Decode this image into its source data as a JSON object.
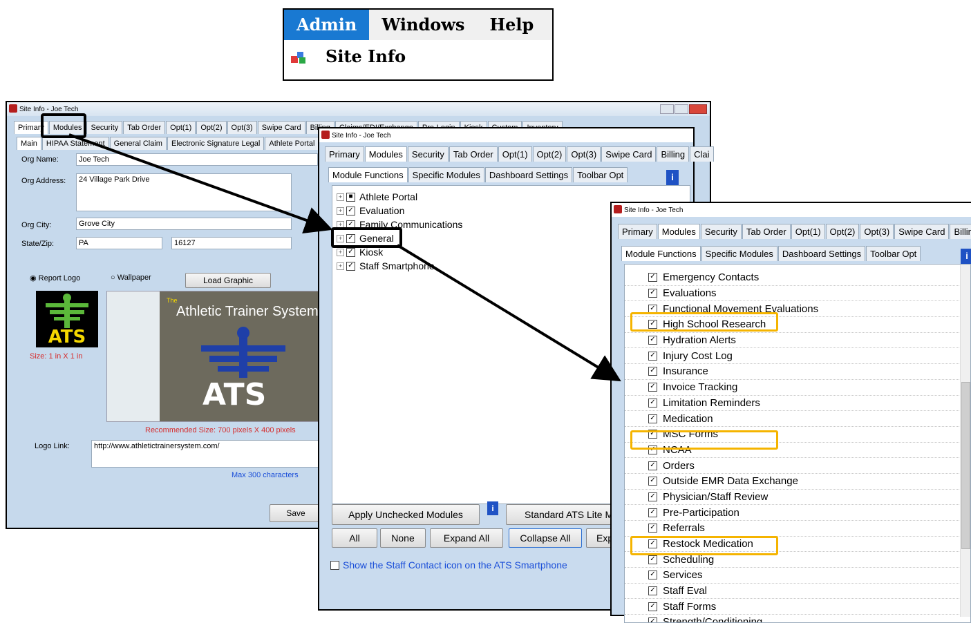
{
  "menu": {
    "items": [
      "Admin",
      "Windows",
      "Help"
    ],
    "site_info": "Site Info"
  },
  "win1": {
    "title": "Site Info - Joe Tech",
    "tabs": [
      "Primary",
      "Modules",
      "Security",
      "Tab Order",
      "Opt(1)",
      "Opt(2)",
      "Opt(3)",
      "Swipe Card",
      "Billing",
      "Claims/EDI/Exchange",
      "Pre-Login",
      "Kiosk",
      "Custom",
      "Inventory"
    ],
    "subtabs": [
      "Main",
      "HIPAA Statement",
      "General Claim",
      "Electronic Signature Legal",
      "Athlete Portal"
    ],
    "org_name_label": "Org Name:",
    "org_name": "Joe Tech",
    "org_address_label": "Org Address:",
    "org_address": "24 Village Park Drive",
    "org_city_label": "Org City:",
    "org_city": "Grove City",
    "state_zip_label": "State/Zip:",
    "state": "PA",
    "zip": "16127",
    "report_logo": "Report Logo",
    "wallpaper": "Wallpaper",
    "load_graphic": "Load Graphic",
    "logo_text": "ATS",
    "size_text": "Size: 1 in X 1 in",
    "banner_the": "The",
    "banner_title": "Athletic Trainer System",
    "banner_logo": "ATS",
    "recommended": "Recommended Size: 700 pixels X 400 pixels",
    "logo_link_label": "Logo Link:",
    "logo_link": "http://www.athletictrainersystem.com/",
    "max_chars": "Max 300 characters",
    "save": "Save"
  },
  "win2": {
    "title": "Site Info - Joe Tech",
    "tabs": [
      "Primary",
      "Modules",
      "Security",
      "Tab Order",
      "Opt(1)",
      "Opt(2)",
      "Opt(3)",
      "Swipe Card",
      "Billing",
      "Clai"
    ],
    "subtabs": [
      "Module Functions",
      "Specific Modules",
      "Dashboard Settings",
      "Toolbar Opt"
    ],
    "tree": [
      "Athlete Portal",
      "Evaluation",
      "Family Communications",
      "General",
      "Kiosk",
      "Staff Smartphone"
    ],
    "apply_unchecked": "Apply Unchecked Modules",
    "standard_ats": "Standard ATS Lite M",
    "all": "All",
    "none": "None",
    "expand_all": "Expand All",
    "collapse_all": "Collapse All",
    "exp": "Exp",
    "show_staff": "Show the Staff Contact icon on the ATS Smartphone"
  },
  "win3": {
    "title": "Site Info - Joe Tech",
    "tabs": [
      "Primary",
      "Modules",
      "Security",
      "Tab Order",
      "Opt(1)",
      "Opt(2)",
      "Opt(3)",
      "Swipe Card",
      "Billing"
    ],
    "subtabs": [
      "Module Functions",
      "Specific Modules",
      "Dashboard Settings",
      "Toolbar Opt"
    ],
    "items": [
      "Emergency Contacts",
      "Evaluations",
      "Functional Movement Evaluations",
      "High School Research",
      "Hydration Alerts",
      "Injury Cost Log",
      "Insurance",
      "Invoice Tracking",
      "Limitation Reminders",
      "Medication",
      "MSC Forms",
      "NCAA",
      "Orders",
      "Outside EMR Data Exchange",
      "Physician/Staff Review",
      "Pre-Participation",
      "Referrals",
      "Restock Medication",
      "Scheduling",
      "Services",
      "Staff Eval",
      "Staff Forms",
      "Strength/Conditioning"
    ]
  },
  "colors": {
    "highlight": "#f5b400",
    "menu_active": "#1979d2",
    "window_bg": "#c6d9ec"
  }
}
